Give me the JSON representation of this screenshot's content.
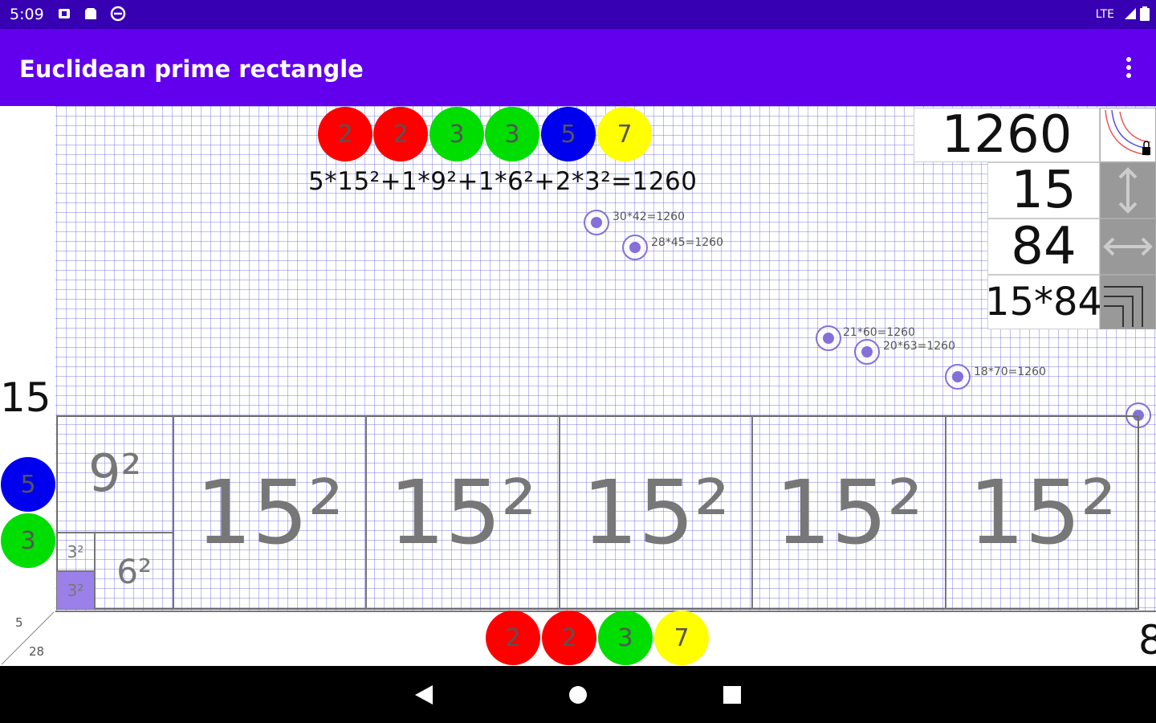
{
  "status_bar": {
    "time": "5:09",
    "network": "LTE"
  },
  "app_bar": {
    "title": "Euclidean prime rectangle"
  },
  "top_factors": [
    "2",
    "2",
    "3",
    "3",
    "5",
    "7"
  ],
  "formula": "5*15²+1*9²+1*6²+2*3²=1260",
  "info": {
    "area": "1260",
    "height": "15",
    "width": "84",
    "product": "15*84"
  },
  "point_labels": [
    "30*42=1260",
    "28*45=1260",
    "21*60=1260",
    "20*63=1260",
    "18*70=1260"
  ],
  "left_label": "15",
  "left_factors": [
    "5",
    "3"
  ],
  "bottom_factors": [
    "2",
    "2",
    "3",
    "7"
  ],
  "right_edge_label": "8",
  "corner": {
    "top": "5",
    "bottom": "28"
  },
  "squares": {
    "s9": "9²",
    "s6": "6²",
    "s3a": "3²",
    "s3b": "3²",
    "s15": [
      "15²",
      "15²",
      "15²",
      "15²",
      "15²"
    ]
  },
  "colors": {
    "status": "#3700b3",
    "appbar": "#6200ee",
    "red": "#ff0000",
    "green": "#00dd00",
    "blue": "#0000ee",
    "yellow": "#ffff00",
    "highlight": "#9b80ea"
  }
}
